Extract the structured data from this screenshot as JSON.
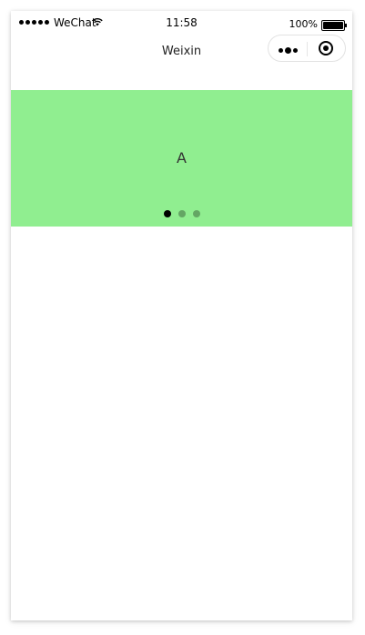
{
  "status_bar": {
    "carrier": "WeChat",
    "time": "11:58",
    "battery_percent": "100%",
    "signal_bars": 5,
    "icons": [
      "signal-icon",
      "wifi-icon",
      "battery-icon"
    ]
  },
  "nav": {
    "title": "Weixin",
    "capsule_icons": [
      "more-icon",
      "close-target-icon"
    ]
  },
  "swiper": {
    "background_color": "#90ee90",
    "current_slide_label": "A",
    "slide_count": 3,
    "active_index": 0,
    "indicator_active_color": "#000000"
  }
}
